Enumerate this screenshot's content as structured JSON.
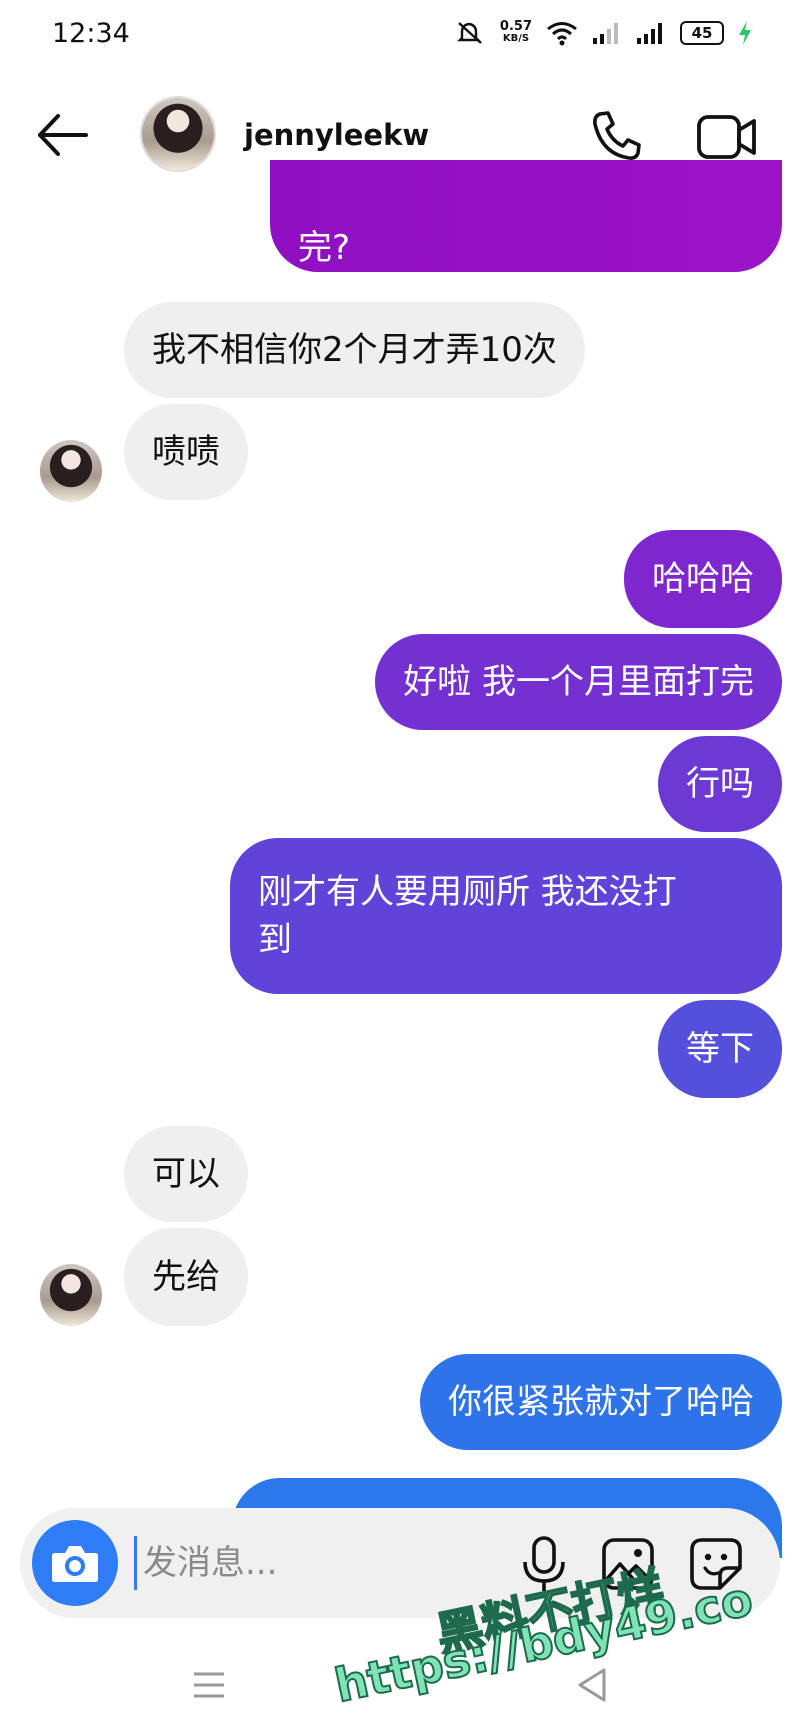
{
  "status_bar": {
    "time": "12:34",
    "net_speed_value": "0.57",
    "net_speed_unit": "KB/S",
    "battery": "45",
    "icons": [
      "mute-icon",
      "wifi-icon",
      "signal-icon",
      "signal-icon",
      "battery-icon",
      "charging-icon"
    ]
  },
  "header": {
    "username": "jennyleekw",
    "icons": [
      "back-arrow-icon",
      "phone-icon",
      "video-camera-icon"
    ]
  },
  "messages": [
    {
      "side": "out",
      "text": "完?"
    },
    {
      "side": "in",
      "text": "我不相信你2个月才弄10次"
    },
    {
      "side": "in",
      "text": "啧啧"
    },
    {
      "side": "out",
      "text": "哈哈哈"
    },
    {
      "side": "out",
      "text": "好啦 我一个月里面打完"
    },
    {
      "side": "out",
      "text": "行吗"
    },
    {
      "side": "out",
      "text_line1": "刚才有人要用厕所 我还没打",
      "text_line2": "到"
    },
    {
      "side": "out",
      "text": "等下"
    },
    {
      "side": "in",
      "text": "可以"
    },
    {
      "side": "in",
      "text": "先给"
    },
    {
      "side": "out",
      "text": "你很紧张就对了哈哈"
    }
  ],
  "composer": {
    "placeholder": "发消息...",
    "icons": [
      "camera-icon",
      "microphone-icon",
      "gallery-icon",
      "sticker-icon"
    ]
  },
  "watermark": {
    "line1": "黑料不打烊",
    "line2": "https://bdy49.co"
  },
  "colors": {
    "gradient_top": "#9b14c8",
    "gradient_mid": "#6a3ad6",
    "gradient_bottom": "#2a78ec",
    "incoming_bubble": "#efefef",
    "camera_button": "#2e7cf6"
  }
}
